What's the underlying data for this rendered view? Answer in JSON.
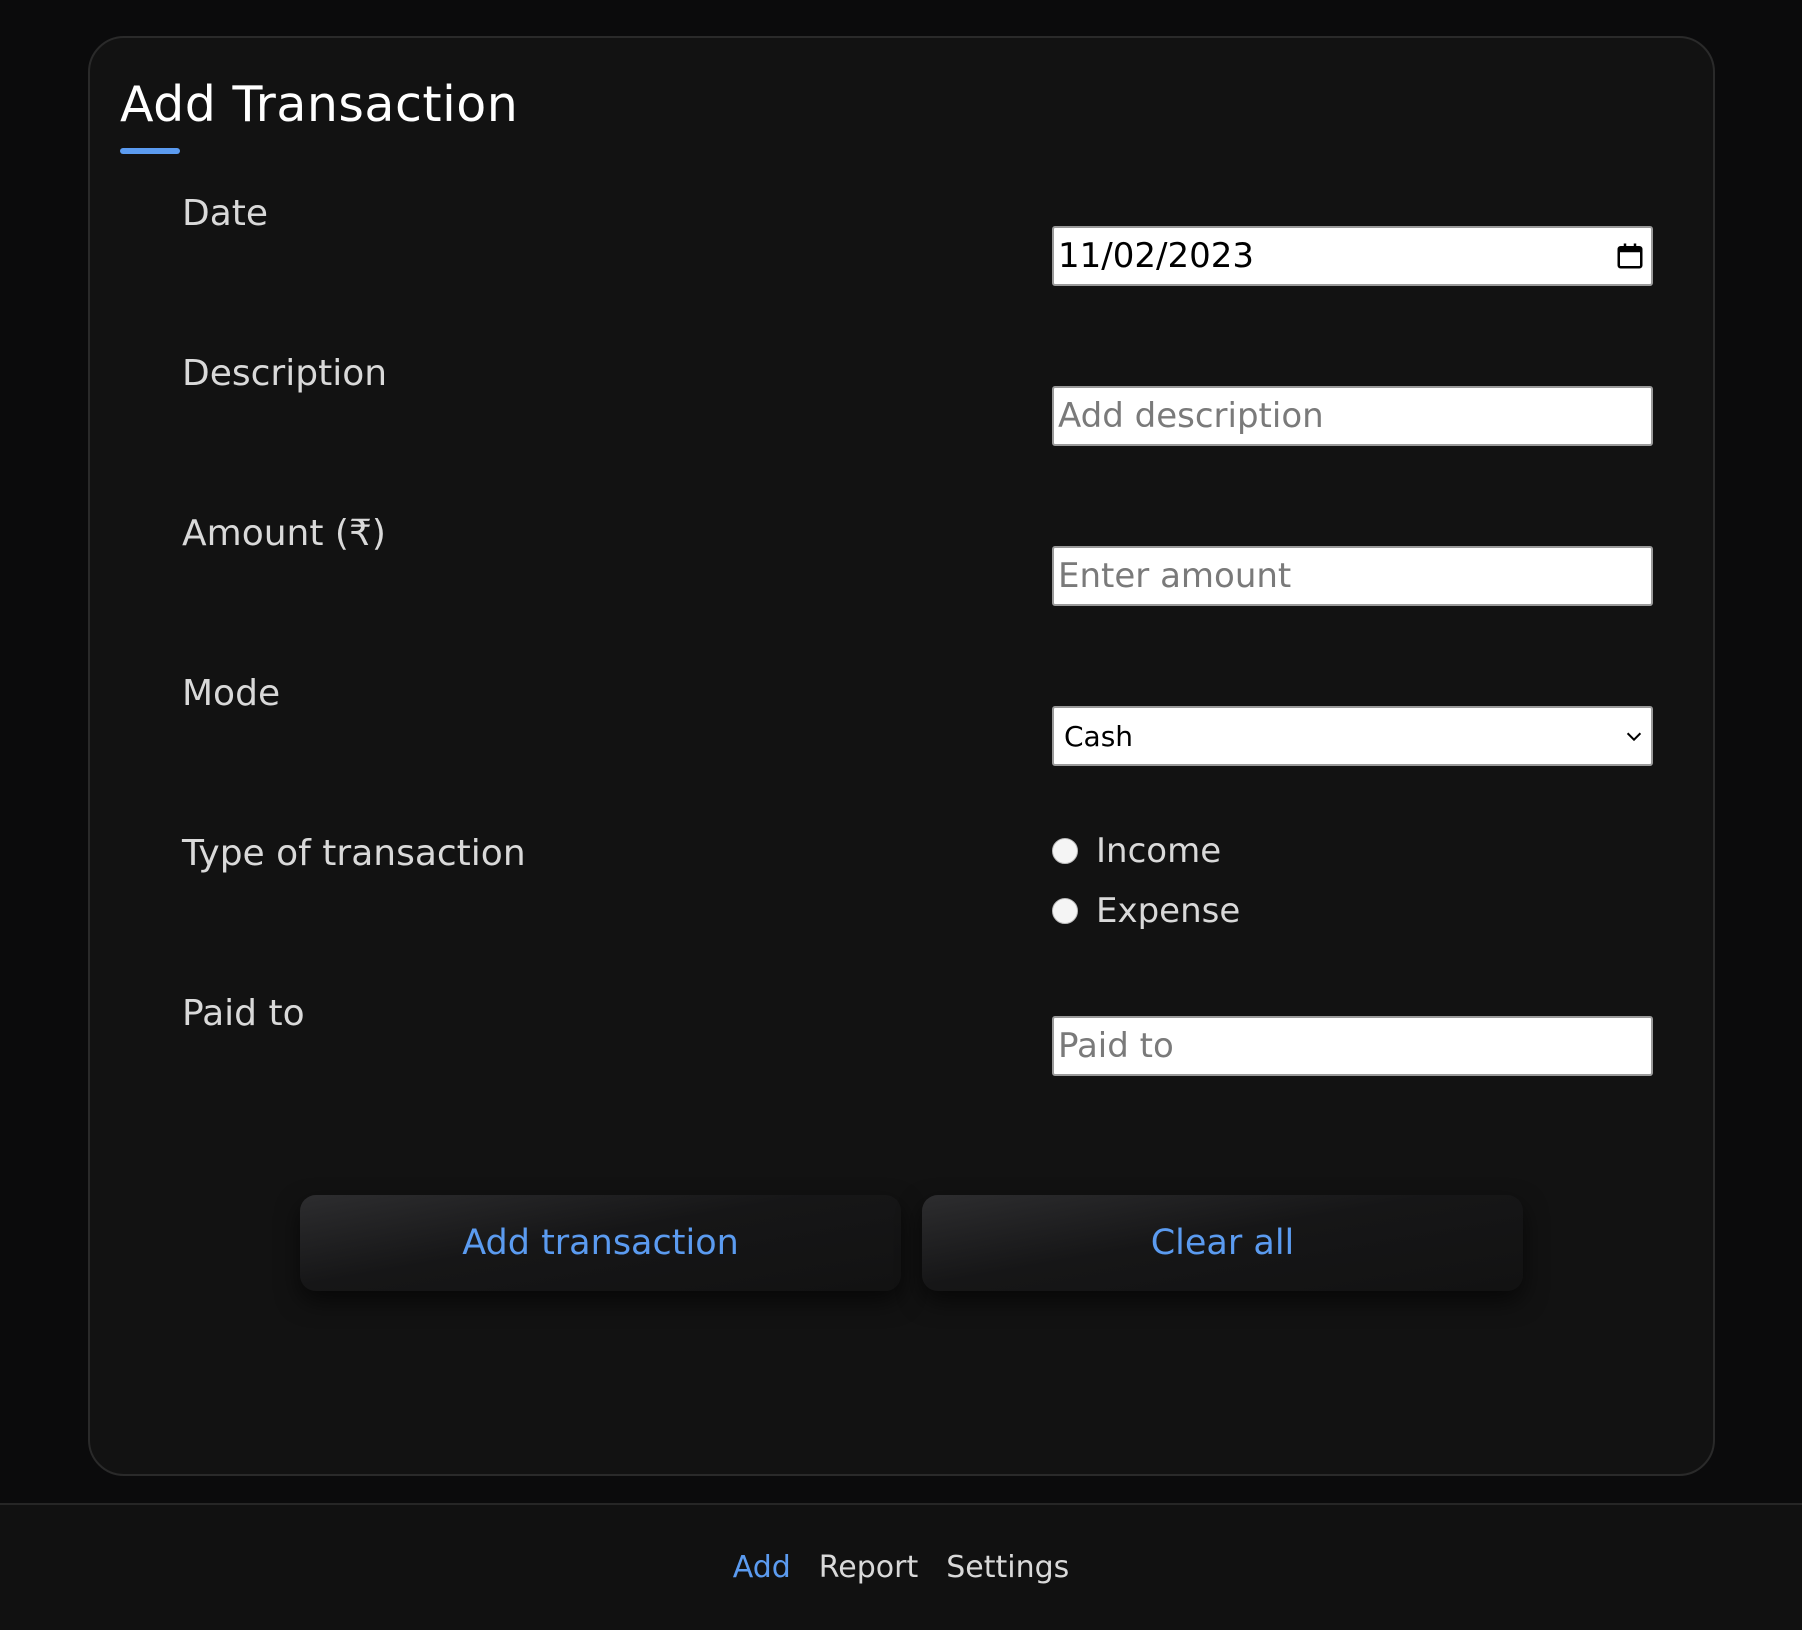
{
  "form": {
    "title": "Add Transaction",
    "date": {
      "label": "Date",
      "value": "11/02/2023",
      "icon": "calendar-icon"
    },
    "description": {
      "label": "Description",
      "placeholder": "Add description"
    },
    "amount": {
      "label": "Amount (₹)",
      "placeholder": "Enter amount"
    },
    "mode": {
      "label": "Mode",
      "selected": "Cash",
      "icon": "chevron-down-icon"
    },
    "type": {
      "label": "Type of transaction",
      "options": [
        {
          "label": "Income",
          "checked": false
        },
        {
          "label": "Expense",
          "checked": false
        }
      ]
    },
    "paid_to": {
      "label": "Paid to",
      "placeholder": "Paid to"
    },
    "buttons": {
      "add": "Add transaction",
      "clear": "Clear all"
    }
  },
  "nav": {
    "items": [
      {
        "label": "Add",
        "active": true
      },
      {
        "label": "Report",
        "active": false
      },
      {
        "label": "Settings",
        "active": false
      }
    ]
  },
  "colors": {
    "accent": "#5b9bf0",
    "background": "#0b0b0c",
    "card": "#121212"
  }
}
